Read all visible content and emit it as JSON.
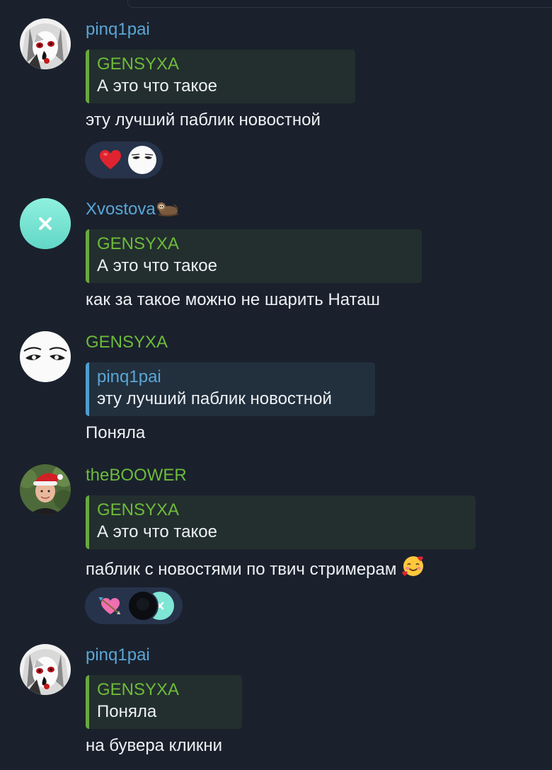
{
  "colors": {
    "background": "#1a212d",
    "author_blue": "#5aa6d6",
    "author_green": "#6dbb3b",
    "quote_green_bar": "#6aa83f",
    "quote_blue_bar": "#4f9fd0",
    "reaction_bg": "#27334a"
  },
  "messages": [
    {
      "author": "pinq1pai",
      "avatar_icon": "anime-girl-avatar",
      "quote": {
        "author": "GENSYXA",
        "text": "А это что такое"
      },
      "text": "эту лучший паблик новостной",
      "reactions": [
        "heart-emoji",
        "eyes-face-avatar"
      ]
    },
    {
      "author": "Xvostova",
      "author_emoji": "sloth-emoji",
      "avatar_letter": "X",
      "quote": {
        "author": "GENSYXA",
        "text": "А это что такое"
      },
      "text": "как за такое можно не шарить Наташ"
    },
    {
      "author": "GENSYXA",
      "avatar_icon": "eyes-face-avatar",
      "quote": {
        "author": "pinq1pai",
        "text": "эту лучший паблик новостной"
      },
      "text": "Поняла"
    },
    {
      "author": "theBOOWER",
      "avatar_icon": "santa-hat-photo-avatar",
      "quote": {
        "author": "GENSYXA",
        "text": "А это что такое"
      },
      "text": "паблик с новостями по твич стримерам",
      "text_emoji": "smiling-face-with-hearts",
      "reactions": [
        "heart-with-arrow-emoji",
        "dark-avatar",
        "x-avatar"
      ],
      "reaction_letter": "X"
    },
    {
      "author": "pinq1pai",
      "avatar_icon": "anime-girl-avatar",
      "quote": {
        "author": "GENSYXA",
        "text": "Поняла"
      },
      "text": "на бувера кликни"
    }
  ]
}
